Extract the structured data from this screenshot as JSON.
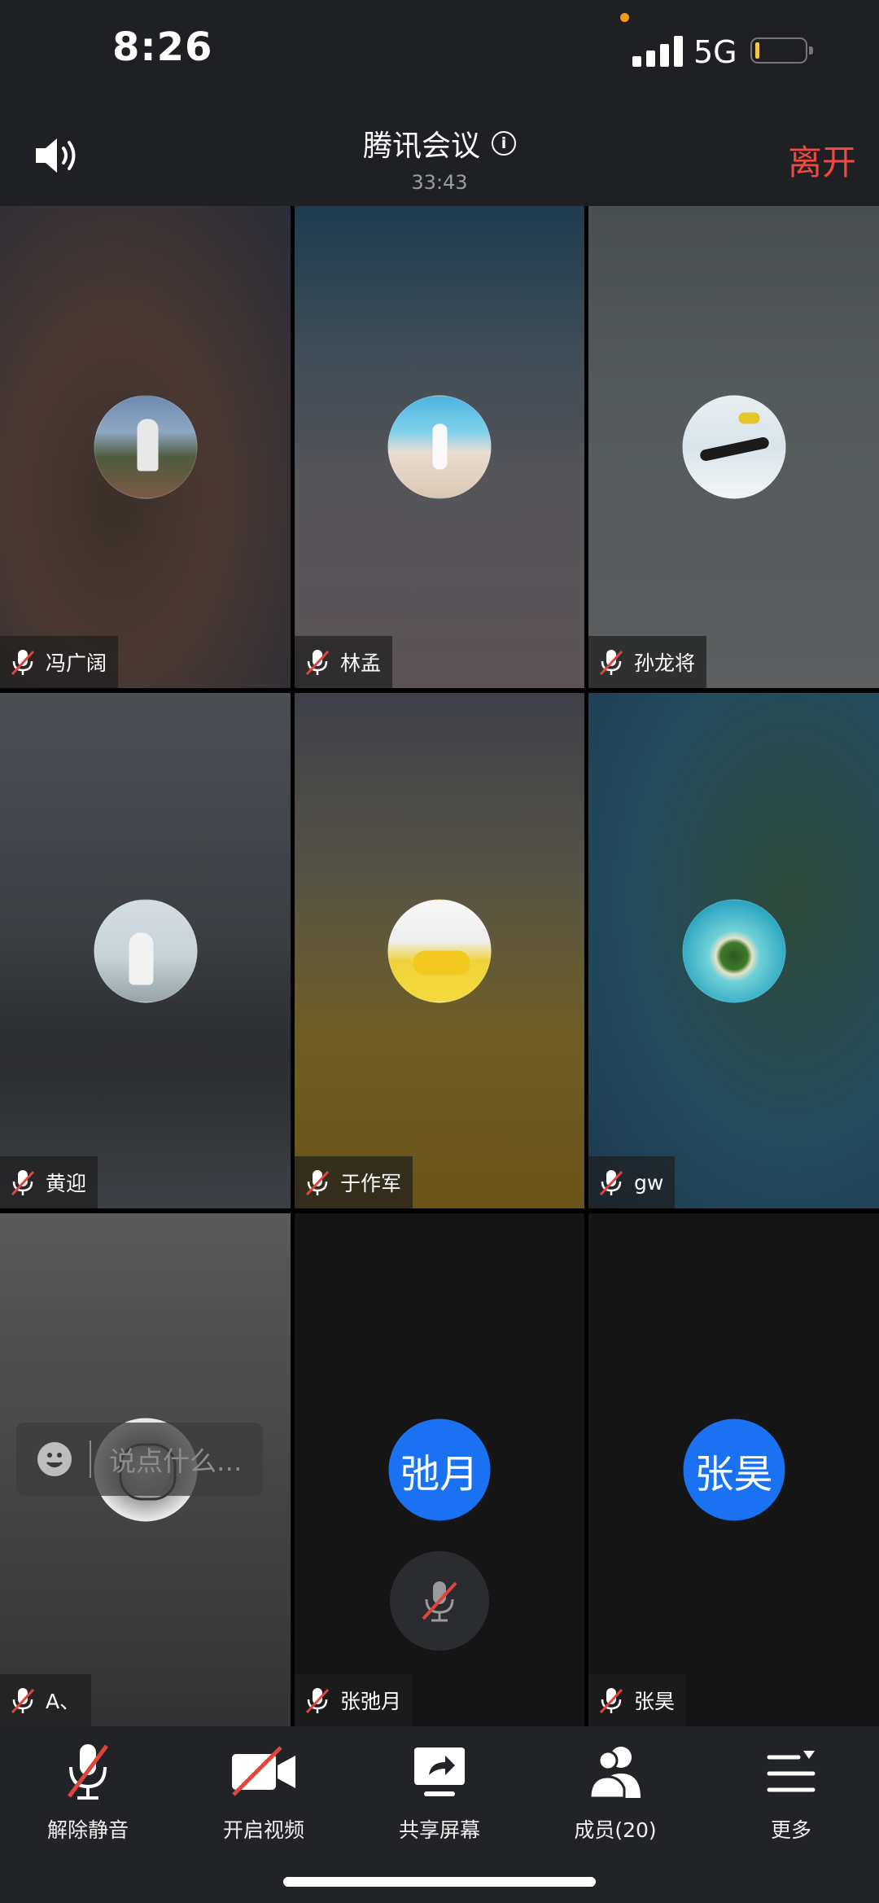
{
  "status_bar": {
    "time": "8:26",
    "network": "5G"
  },
  "header": {
    "title": "腾讯会议",
    "duration": "33:43",
    "leave_label": "离开"
  },
  "participants": [
    {
      "name": "冯广阔"
    },
    {
      "name": "林孟"
    },
    {
      "name": "孙龙将"
    },
    {
      "name": "黄迎"
    },
    {
      "name": "于作军"
    },
    {
      "name": "gw"
    },
    {
      "name": "A、"
    },
    {
      "name": "张弛月",
      "avatar_text": "弛月"
    },
    {
      "name": "张昊",
      "avatar_text": "张昊"
    }
  ],
  "chat": {
    "placeholder": "说点什么..."
  },
  "toolbar": {
    "unmute": "解除静音",
    "start_video": "开启视频",
    "share_screen": "共享屏幕",
    "members": "成员(20)",
    "more": "更多"
  },
  "colors": {
    "accent": "#1a72f3",
    "leave": "#ee4a3f",
    "mute_slash": "#e0443c"
  }
}
